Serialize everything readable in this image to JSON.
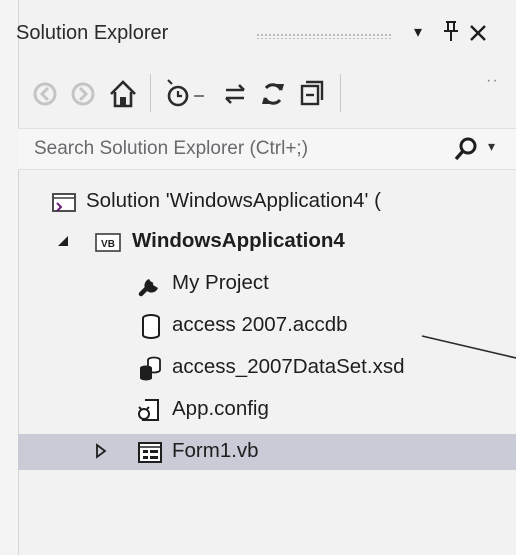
{
  "solution_explorer": {
    "title": "Solution Explorer",
    "pin_glyph": "२",
    "close_glyph": "✕",
    "dropdown_glyph": "▾"
  },
  "toolbar": {
    "overflow": "··"
  },
  "search": {
    "placeholder": "Search Solution Explorer (Ctrl+;)",
    "dropdown_glyph": "▾"
  },
  "tree": {
    "solution_label": "Solution 'WindowsApplication4' (",
    "project_label": "WindowsApplication4",
    "items": [
      {
        "label": "My Project"
      },
      {
        "label": "access 2007.accdb"
      },
      {
        "label": "access_2007DataSet.xsd"
      },
      {
        "label": "App.config"
      },
      {
        "label": "Form1.vb"
      }
    ],
    "project_badge": "VB"
  },
  "colors": {
    "selection": "#c9cbd6",
    "panel_bg": "#f2f2f3",
    "text": "#1e1e1e"
  }
}
